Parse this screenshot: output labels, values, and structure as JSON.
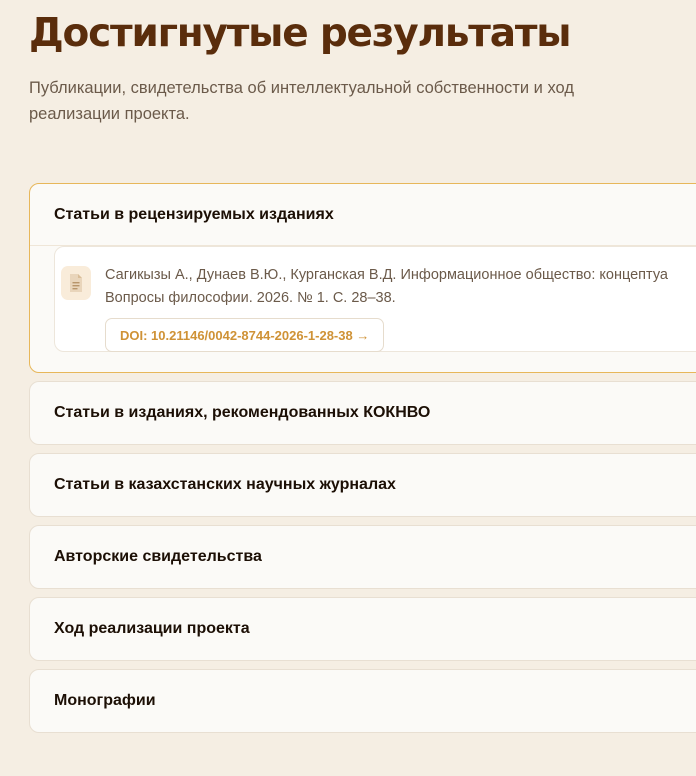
{
  "page": {
    "title": "Достигнутые результаты",
    "subtitle": "Публикации, свидетельства об интеллектуальной собственности и ход реализации проекта."
  },
  "accordion": {
    "sections": [
      {
        "label": "Статьи в рецензируемых изданиях",
        "expanded": true,
        "publications": [
          {
            "citation_line1": "Сагикызы А., Дунаев В.Ю., Курганская В.Д. Информационное общество: концептуа",
            "citation_line2": "Вопросы философии. 2026. № 1. С. 28–38.",
            "doi_label": "DOI: 10.21146/0042-8744-2026-1-28-38 →",
            "icon": "document-icon"
          }
        ]
      },
      {
        "label": "Статьи в изданиях, рекомендованных КОКНВО",
        "expanded": false
      },
      {
        "label": "Статьи в казахстанских научных журналах",
        "expanded": false
      },
      {
        "label": "Авторские свидетельства",
        "expanded": false
      },
      {
        "label": "Ход реализации проекта",
        "expanded": false
      },
      {
        "label": "Монографии",
        "expanded": false
      }
    ]
  },
  "colors": {
    "background": "#f5eee3",
    "title": "#5a2d0c",
    "accent": "#cf9236",
    "open_border": "#e7b75a"
  }
}
